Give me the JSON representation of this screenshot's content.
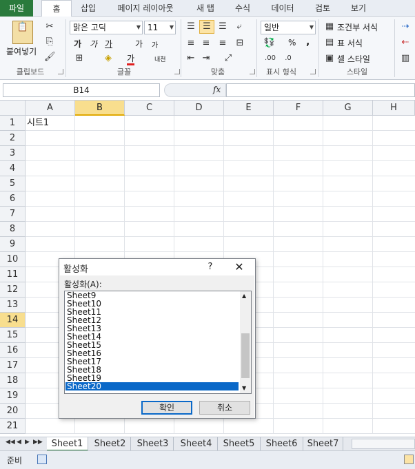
{
  "ribbon_tabs": [
    {
      "label": "파일"
    },
    {
      "label": "홈"
    },
    {
      "label": "삽입"
    },
    {
      "label": "페이지 레이아웃"
    },
    {
      "label": "새 탭"
    },
    {
      "label": "수식"
    },
    {
      "label": "데이터"
    },
    {
      "label": "검토"
    },
    {
      "label": "보기"
    }
  ],
  "ribbon": {
    "paste_label": "붙여넣기",
    "font_name": "맑은 고딕",
    "font_size": "11",
    "bold": "가",
    "italic": "가",
    "underline": "가",
    "grow_font": "가",
    "shrink_font": "가",
    "font_color_glyph": "가",
    "phonetic": "내천",
    "number_format": "일반",
    "percent": "%",
    "comma": ",",
    "cond_format": "조건부 서식",
    "table_format": "표 서식",
    "cell_style": "셀 스타일",
    "groups": [
      "클립보드",
      "글꼴",
      "맞춤",
      "표시 형식",
      "스타일"
    ]
  },
  "formula_bar": {
    "name_box": "B14",
    "fx": "fx",
    "formula": ""
  },
  "grid": {
    "columns": [
      "A",
      "B",
      "C",
      "D",
      "E",
      "F",
      "G",
      "H"
    ],
    "selected_column": "B",
    "rows": [
      "1",
      "2",
      "3",
      "4",
      "5",
      "6",
      "7",
      "8",
      "9",
      "10",
      "11",
      "12",
      "13",
      "14",
      "15",
      "16",
      "17",
      "18",
      "19",
      "20",
      "21"
    ],
    "selected_row": "14",
    "cell_a1": "시트1"
  },
  "sheet_tabs": [
    "Sheet1",
    "Sheet2",
    "Sheet3",
    "Sheet4",
    "Sheet5",
    "Sheet6",
    "Sheet7"
  ],
  "status": {
    "ready": "준비"
  },
  "dialog": {
    "title": "활성화",
    "help": "?",
    "close": "✕",
    "list_label": "활성화(A):",
    "sheets": [
      "Sheet9",
      "Sheet10",
      "Sheet11",
      "Sheet12",
      "Sheet13",
      "Sheet14",
      "Sheet15",
      "Sheet16",
      "Sheet17",
      "Sheet18",
      "Sheet19",
      "Sheet20"
    ],
    "selected_sheet": "Sheet20",
    "ok": "확인",
    "cancel": "취소",
    "accent_color": "#0a68c8"
  }
}
